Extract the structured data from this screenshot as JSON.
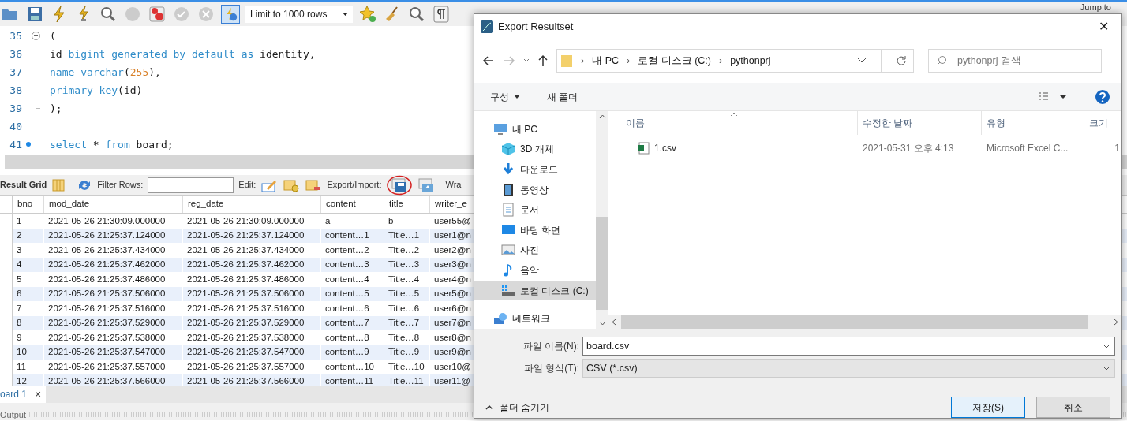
{
  "toolbar": {
    "limit": "Limit to 1000 rows",
    "icons": [
      {
        "kind": "folder"
      },
      {
        "kind": "save"
      },
      {
        "kind": "bolt"
      },
      {
        "kind": "bolt-cursor"
      },
      {
        "kind": "magnifier"
      },
      {
        "kind": "stop"
      },
      {
        "kind": "error"
      },
      {
        "kind": "check"
      },
      {
        "kind": "cancel"
      },
      {
        "kind": "toggle",
        "selected": true
      }
    ],
    "after": [
      {
        "kind": "star"
      },
      {
        "kind": "broom"
      },
      {
        "kind": "magnifier"
      },
      {
        "kind": "pilcrow"
      }
    ],
    "right_label": "Jump to"
  },
  "editor": {
    "lines": [
      {
        "number": "35",
        "kind": "fold-start",
        "tokens": [
          {
            "kind": "plain",
            "text": "("
          }
        ]
      },
      {
        "number": "36",
        "kind": "fold-body",
        "tokens": [
          {
            "kind": "plain",
            "text": "id "
          },
          {
            "kind": "keyword",
            "text": "bigint generated by default as"
          },
          {
            "kind": "plain",
            "text": " identity,"
          }
        ]
      },
      {
        "number": "37",
        "kind": "fold-body",
        "tokens": [
          {
            "kind": "keyword",
            "text": "name varchar"
          },
          {
            "kind": "plain",
            "text": "("
          },
          {
            "kind": "number",
            "text": "255"
          },
          {
            "kind": "plain",
            "text": "),"
          }
        ]
      },
      {
        "number": "38",
        "kind": "fold-body",
        "tokens": [
          {
            "kind": "keyword",
            "text": "primary key"
          },
          {
            "kind": "plain",
            "text": "(id)"
          }
        ]
      },
      {
        "number": "39",
        "kind": "fold-end",
        "tokens": [
          {
            "kind": "plain",
            "text": ");"
          }
        ]
      },
      {
        "number": "40",
        "kind": "plain"
      },
      {
        "number": "41",
        "kind": "plain",
        "marker": true,
        "tokens": [
          {
            "kind": "keyword",
            "text": "select"
          },
          {
            "kind": "plain",
            "text": " * "
          },
          {
            "kind": "keyword",
            "text": "from"
          },
          {
            "kind": "plain",
            "text": " board;"
          }
        ]
      }
    ]
  },
  "result_toolbar": {
    "title": "Result Grid",
    "filter_label": "Filter Rows:",
    "edit_label": "Edit:",
    "export_label": "Export/Import:",
    "wrap_label": "Wra"
  },
  "table": {
    "columns": [
      "bno",
      "mod_date",
      "reg_date",
      "content",
      "title",
      "writer_e"
    ],
    "rows": [
      [
        "1",
        "2021-05-26 21:30:09.000000",
        "2021-05-26 21:30:09.000000",
        "a",
        "b",
        "user55@"
      ],
      [
        "2",
        "2021-05-26 21:25:37.124000",
        "2021-05-26 21:25:37.124000",
        "content…1",
        "Title…1",
        "user1@n"
      ],
      [
        "3",
        "2021-05-26 21:25:37.434000",
        "2021-05-26 21:25:37.434000",
        "content…2",
        "Title…2",
        "user2@n"
      ],
      [
        "4",
        "2021-05-26 21:25:37.462000",
        "2021-05-26 21:25:37.462000",
        "content…3",
        "Title…3",
        "user3@n"
      ],
      [
        "5",
        "2021-05-26 21:25:37.486000",
        "2021-05-26 21:25:37.486000",
        "content…4",
        "Title…4",
        "user4@n"
      ],
      [
        "6",
        "2021-05-26 21:25:37.506000",
        "2021-05-26 21:25:37.506000",
        "content…5",
        "Title…5",
        "user5@n"
      ],
      [
        "7",
        "2021-05-26 21:25:37.516000",
        "2021-05-26 21:25:37.516000",
        "content…6",
        "Title…6",
        "user6@n"
      ],
      [
        "8",
        "2021-05-26 21:25:37.529000",
        "2021-05-26 21:25:37.529000",
        "content…7",
        "Title…7",
        "user7@n"
      ],
      [
        "9",
        "2021-05-26 21:25:37.538000",
        "2021-05-26 21:25:37.538000",
        "content…8",
        "Title…8",
        "user8@n"
      ],
      [
        "10",
        "2021-05-26 21:25:37.547000",
        "2021-05-26 21:25:37.547000",
        "content…9",
        "Title…9",
        "user9@n"
      ],
      [
        "11",
        "2021-05-26 21:25:37.557000",
        "2021-05-26 21:25:37.557000",
        "content…10",
        "Title…10",
        "user10@"
      ],
      [
        "12",
        "2021-05-26 21:25:37.566000",
        "2021-05-26 21:25:37.566000",
        "content…11",
        "Title…11",
        "user11@"
      ]
    ]
  },
  "result_tab": {
    "label": "oard 1",
    "close": "×"
  },
  "output_label": "Output",
  "dialog": {
    "title": "Export Resultset",
    "close": "✕",
    "breadcrumb": [
      "내 PC",
      "로컬 디스크 (C:)",
      "pythonprj"
    ],
    "separator": "›",
    "search_placeholder": "pythonprj 검색",
    "organize": "구성",
    "new_folder": "새 폴더",
    "nav": [
      {
        "label": "내 PC",
        "kind": "pc",
        "selected": false
      },
      {
        "label": "3D 개체",
        "kind": "cube",
        "selected": false
      },
      {
        "label": "다운로드",
        "kind": "download",
        "selected": false
      },
      {
        "label": "동영상",
        "kind": "film",
        "selected": false
      },
      {
        "label": "문서",
        "kind": "doc",
        "selected": false
      },
      {
        "label": "바탕 화면",
        "kind": "desktop",
        "selected": false
      },
      {
        "label": "사진",
        "kind": "photo",
        "selected": false
      },
      {
        "label": "음악",
        "kind": "music",
        "selected": false
      },
      {
        "label": "로컬 디스크 (C:)",
        "kind": "disk",
        "selected": true
      },
      {
        "label": "네트워크",
        "kind": "network",
        "selected": false
      }
    ],
    "columns": [
      "이름",
      "수정한 날짜",
      "유형",
      "크기"
    ],
    "files": [
      {
        "name": "1.csv",
        "modified": "2021-05-31 오후 4:13",
        "type": "Microsoft Excel C...",
        "size": "1"
      }
    ],
    "filename_label": "파일 이름(N):",
    "filename": "board.csv",
    "filetype_label": "파일 형식(T):",
    "filetype": "CSV (*.csv)",
    "hide_folders": "폴더 숨기기",
    "save": "저장(S)",
    "cancel": "취소"
  }
}
